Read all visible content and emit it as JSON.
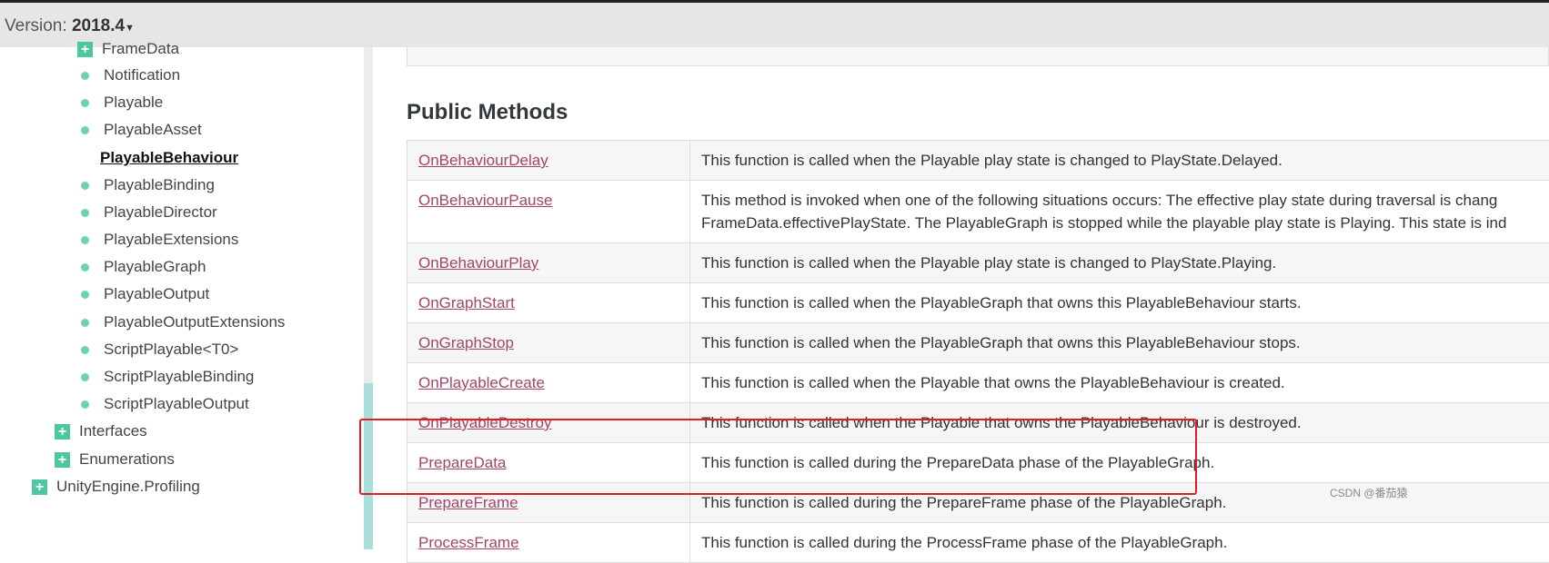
{
  "topbar": {
    "version_label": "Version:",
    "version_value": "2018.4"
  },
  "sidebar": {
    "items": [
      {
        "label": "FrameData",
        "kind": "plus",
        "level": 3
      },
      {
        "label": "Notification",
        "kind": "dot",
        "level": 3
      },
      {
        "label": "Playable",
        "kind": "dot",
        "level": 3
      },
      {
        "label": "PlayableAsset",
        "kind": "dot",
        "level": 3
      },
      {
        "label": "PlayableBehaviour",
        "kind": "current",
        "level": 3
      },
      {
        "label": "PlayableBinding",
        "kind": "dot",
        "level": 3
      },
      {
        "label": "PlayableDirector",
        "kind": "dot",
        "level": 3
      },
      {
        "label": "PlayableExtensions",
        "kind": "dot",
        "level": 3
      },
      {
        "label": "PlayableGraph",
        "kind": "dot",
        "level": 3
      },
      {
        "label": "PlayableOutput",
        "kind": "dot",
        "level": 3
      },
      {
        "label": "PlayableOutputExtensions",
        "kind": "dot",
        "level": 3
      },
      {
        "label": "ScriptPlayable<T0>",
        "kind": "dot",
        "level": 3
      },
      {
        "label": "ScriptPlayableBinding",
        "kind": "dot",
        "level": 3
      },
      {
        "label": "ScriptPlayableOutput",
        "kind": "dot",
        "level": 3
      },
      {
        "label": "Interfaces",
        "kind": "plus",
        "level": 2
      },
      {
        "label": "Enumerations",
        "kind": "plus",
        "level": 2
      },
      {
        "label": "UnityEngine.Profiling",
        "kind": "plus",
        "level": 1
      }
    ]
  },
  "main": {
    "heading": "Public Methods",
    "methods": [
      {
        "name": "OnBehaviourDelay",
        "desc": "This function is called when the Playable play state is changed to PlayState.Delayed."
      },
      {
        "name": "OnBehaviourPause",
        "desc": "This method is invoked when one of the following situations occurs: The effective play state during traversal is chang",
        "desc2": "FrameData.effectivePlayState. The PlayableGraph is stopped while the playable play state is Playing. This state is ind"
      },
      {
        "name": "OnBehaviourPlay",
        "desc": "This function is called when the Playable play state is changed to PlayState.Playing."
      },
      {
        "name": "OnGraphStart",
        "desc": "This function is called when the PlayableGraph that owns this PlayableBehaviour starts."
      },
      {
        "name": "OnGraphStop",
        "desc": "This function is called when the PlayableGraph that owns this PlayableBehaviour stops."
      },
      {
        "name": "OnPlayableCreate",
        "desc": "This function is called when the Playable that owns the PlayableBehaviour is created."
      },
      {
        "name": "OnPlayableDestroy",
        "desc": "This function is called when the Playable that owns the PlayableBehaviour is destroyed."
      },
      {
        "name": "PrepareData",
        "desc": "This function is called during the PrepareData phase of the PlayableGraph."
      },
      {
        "name": "PrepareFrame",
        "desc": "This function is called during the PrepareFrame phase of the PlayableGraph."
      },
      {
        "name": "ProcessFrame",
        "desc": "This function is called during the ProcessFrame phase of the PlayableGraph."
      }
    ]
  },
  "watermark": "CSDN @番茄猿",
  "colors": {
    "link": "#a2456a",
    "dot": "#6fd0b8",
    "plus": "#4cc79f",
    "highlight": "#e02020"
  }
}
